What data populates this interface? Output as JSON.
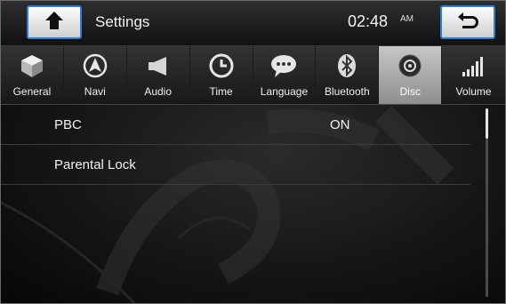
{
  "header": {
    "title": "Settings",
    "time": "02:48",
    "ampm": "AM",
    "home_icon": "home-icon",
    "back_icon": "back-arrow-icon"
  },
  "tabs": [
    {
      "label": "General",
      "icon": "cube-icon",
      "active": false
    },
    {
      "label": "Navi",
      "icon": "navigation-arrow-icon",
      "active": false
    },
    {
      "label": "Audio",
      "icon": "speaker-icon",
      "active": false
    },
    {
      "label": "Time",
      "icon": "clock-icon",
      "active": false
    },
    {
      "label": "Language",
      "icon": "speech-bubble-icon",
      "active": false
    },
    {
      "label": "Bluetooth",
      "icon": "bluetooth-icon",
      "active": false
    },
    {
      "label": "Disc",
      "icon": "disc-icon",
      "active": true
    },
    {
      "label": "Volume",
      "icon": "volume-bars-icon",
      "active": false
    }
  ],
  "settings": [
    {
      "label": "PBC",
      "value": "ON"
    },
    {
      "label": "Parental Lock",
      "value": ""
    }
  ],
  "colors": {
    "accent_border": "#2f7fd6",
    "active_tab": "#b0b0b0"
  }
}
